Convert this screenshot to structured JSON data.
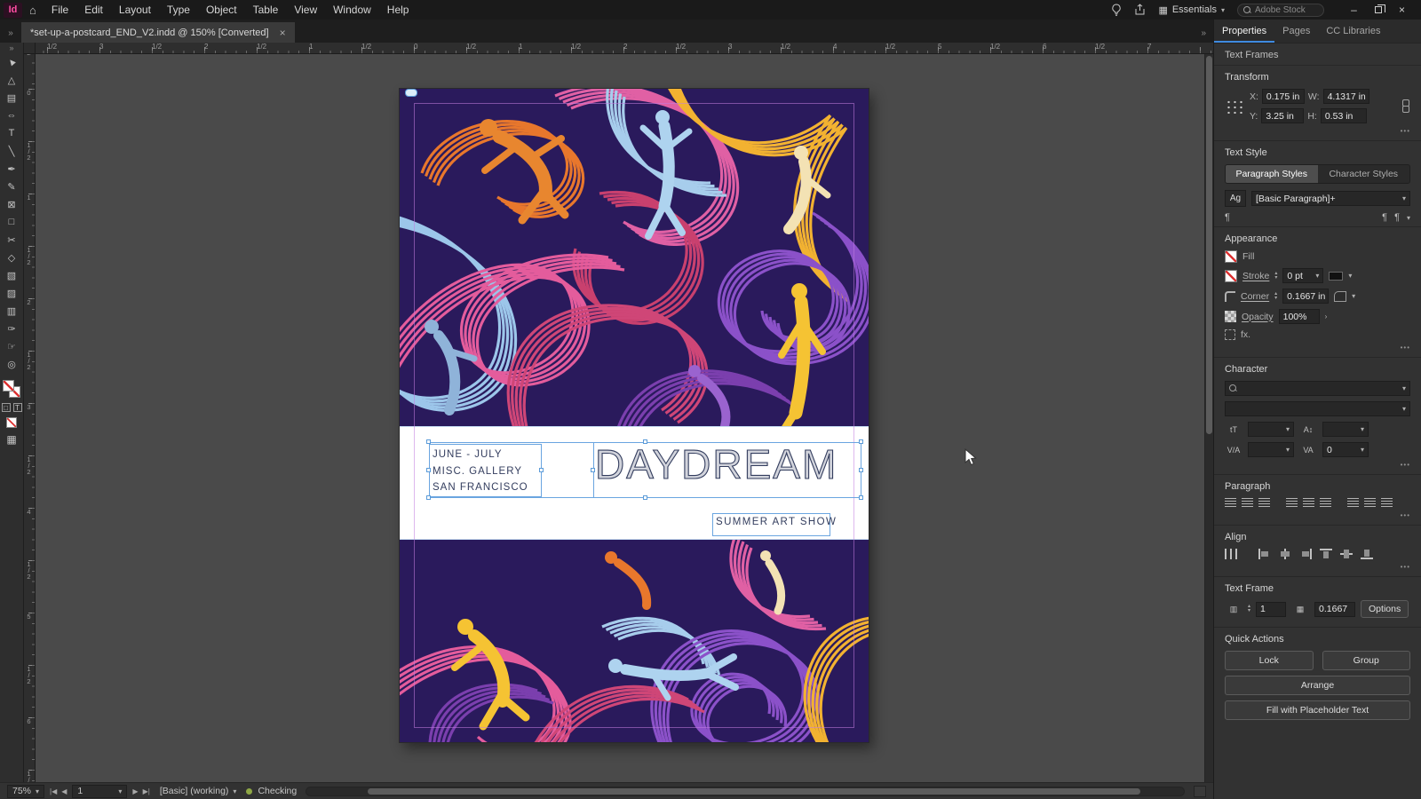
{
  "colors": {
    "accent_blue": "#3f8ae0",
    "selection_frame": "#6aa5e0",
    "margin_guide": "#c37ee0",
    "preflight_dot": "#8fa845",
    "art_background": "#2a1a5c",
    "art_pink": "#e45c9c",
    "art_magenta": "#cf4677",
    "art_purple": "#8b51c9",
    "art_violet": "#7b3fae",
    "art_orange": "#e8772c",
    "art_yellow": "#f2b231",
    "art_light_blue": "#a7cdec",
    "art_cream": "#f3e2b4"
  },
  "icons": {
    "overflow": "»",
    "close": "×",
    "caret": "▾",
    "stepper_up": "▴",
    "stepper_down": "▾",
    "more": "•••",
    "pilcrow": "¶",
    "home": "⌂",
    "minimize": "–",
    "chevron_right": "›",
    "font_size": "tT",
    "leading": "A↕",
    "kerning": "V/A",
    "tracking": "VA",
    "columns": "▥",
    "inset": "▦",
    "workspace": "▦",
    "container": "□",
    "text": "T",
    "nav_first": "|◀",
    "nav_prev": "◀",
    "nav_next": "▶",
    "nav_last": "▶|"
  },
  "menubar": {
    "app_logo": "Id",
    "menus": [
      "File",
      "Edit",
      "Layout",
      "Type",
      "Object",
      "Table",
      "View",
      "Window",
      "Help"
    ],
    "workspace_label": "Essentials",
    "search_placeholder": "Adobe Stock"
  },
  "tabbar": {
    "active_tab": "*set-up-a-postcard_END_V2.indd @ 150% [Converted]"
  },
  "tools": [
    {
      "name": "selection-tool",
      "glyph": "▲"
    },
    {
      "name": "direct-selection-tool",
      "glyph": "△"
    },
    {
      "name": "page-tool",
      "glyph": "▤"
    },
    {
      "name": "gap-tool",
      "glyph": "⇔"
    },
    {
      "name": "type-tool",
      "glyph": "T"
    },
    {
      "name": "line-tool",
      "glyph": "╲"
    },
    {
      "name": "pen-tool",
      "glyph": "✒"
    },
    {
      "name": "pencil-tool",
      "glyph": "✎"
    },
    {
      "name": "rectangle-frame-tool",
      "glyph": "⊠"
    },
    {
      "name": "rectangle-tool",
      "glyph": "□"
    },
    {
      "name": "scissors-tool",
      "glyph": "✂"
    },
    {
      "name": "free-transform-tool",
      "glyph": "◇"
    },
    {
      "name": "gradient-swatch-tool",
      "glyph": "▧"
    },
    {
      "name": "gradient-feather-tool",
      "glyph": "▨"
    },
    {
      "name": "note-tool",
      "glyph": "▥"
    },
    {
      "name": "eyedropper-tool",
      "glyph": "✑"
    },
    {
      "name": "hand-tool",
      "glyph": "☞"
    },
    {
      "name": "zoom-tool",
      "glyph": "◎"
    }
  ],
  "rulers": {
    "horizontal": [
      "1/2",
      "3",
      "1/2",
      "2",
      "1/2",
      "1",
      "1/2",
      "0",
      "1/2",
      "1",
      "1/2",
      "2",
      "1/2",
      "3",
      "1/2",
      "4",
      "1/2",
      "5",
      "1/2",
      "6",
      "1/2",
      "7"
    ],
    "vertical": [
      "1/2",
      "0",
      "1/2",
      "1",
      "1/2",
      "2",
      "1/2",
      "3",
      "1/2",
      "4",
      "1/2",
      "5",
      "1/2",
      "6",
      "1/2"
    ]
  },
  "document": {
    "info_lines": [
      "JUNE - JULY",
      "MISC. GALLERY",
      "SAN FRANCISCO"
    ],
    "title": "DAYDREAM",
    "subtitle": "SUMMER ART SHOW"
  },
  "panel": {
    "tabs": [
      "Properties",
      "Pages",
      "CC Libraries"
    ],
    "context_label": "Text Frames",
    "transform": {
      "header": "Transform",
      "x_label": "X:",
      "x_value": "0.175 in",
      "y_label": "Y:",
      "y_value": "3.25 in",
      "w_label": "W:",
      "w_value": "4.1317 in",
      "h_label": "H:",
      "h_value": "0.53 in"
    },
    "text_style": {
      "header": "Text Style",
      "paragraph_styles_tab": "Paragraph Styles",
      "character_styles_tab": "Character Styles",
      "style_sample": "Ag",
      "style_name": "[Basic Paragraph]+"
    },
    "appearance": {
      "header": "Appearance",
      "fill_label": "Fill",
      "stroke_label": "Stroke",
      "stroke_value": "0 pt",
      "corner_label": "Corner",
      "corner_value": "0.1667 in",
      "opacity_label": "Opacity",
      "opacity_value": "100%",
      "fx_label": "fx."
    },
    "character": {
      "header": "Character",
      "tracking_value": "0"
    },
    "paragraph": {
      "header": "Paragraph"
    },
    "align": {
      "header": "Align"
    },
    "text_frame": {
      "header": "Text Frame",
      "columns_value": "1",
      "inset_value": "0.1667",
      "options_label": "Options"
    },
    "quick_actions": {
      "header": "Quick Actions",
      "lock": "Lock",
      "group": "Group",
      "arrange": "Arrange",
      "fill_placeholder": "Fill with Placeholder Text"
    }
  },
  "statusbar": {
    "zoom": "75%",
    "page": "1",
    "preflight_profile": "[Basic] (working)",
    "preflight_status": "Checking"
  }
}
